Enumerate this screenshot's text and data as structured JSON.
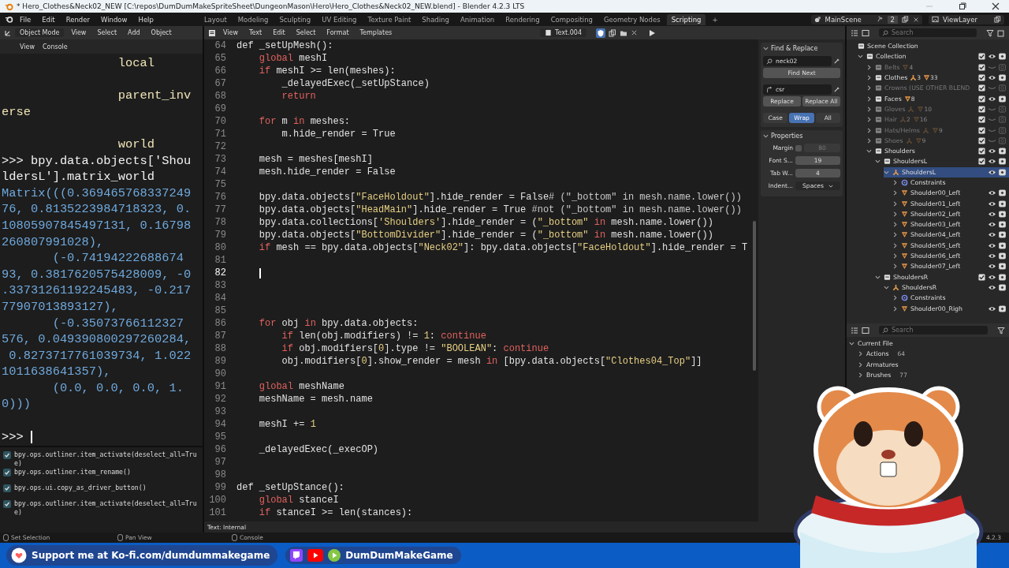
{
  "window": {
    "title": "* Hero_Clothes&Neck02_NEW [C:\\repos\\DumDumMakeSpriteSheet\\DungeonMason\\Hero\\Hero_Clothes&Neck02_NEW.blend] - Blender 4.2.3 LTS"
  },
  "menu": [
    "File",
    "Edit",
    "Render",
    "Window",
    "Help"
  ],
  "workspaces": [
    {
      "label": "Layout",
      "selected": false
    },
    {
      "label": "Modeling",
      "selected": false
    },
    {
      "label": "Sculpting",
      "selected": false
    },
    {
      "label": "UV Editing",
      "selected": false
    },
    {
      "label": "Texture Paint",
      "selected": false
    },
    {
      "label": "Shading",
      "selected": false
    },
    {
      "label": "Animation",
      "selected": false
    },
    {
      "label": "Rendering",
      "selected": false
    },
    {
      "label": "Compositing",
      "selected": false
    },
    {
      "label": "Geometry Nodes",
      "selected": false
    },
    {
      "label": "Scripting",
      "selected": true
    }
  ],
  "add_workspace": "+",
  "scene": {
    "name": "MainScene",
    "users": "2",
    "view_layer": "ViewLayer"
  },
  "viewport_header": {
    "mode": "Object Mode",
    "menus": [
      "View",
      "Select",
      "Add",
      "Object"
    ]
  },
  "console": {
    "menus": [
      "View",
      "Console"
    ],
    "prompt": ">>> ",
    "lines": [
      {
        "kind": "output",
        "text": "                local"
      },
      {
        "kind": "blank"
      },
      {
        "kind": "output",
        "text": "                parent_inv"
      },
      {
        "kind": "output",
        "text": "erse"
      },
      {
        "kind": "blank"
      },
      {
        "kind": "output",
        "text": "                world"
      },
      {
        "kind": "input",
        "text": ">>> bpy.data.objects['Shou"
      },
      {
        "kind": "input",
        "text": "ldersL'].matrix_world"
      },
      {
        "kind": "result",
        "text": "Matrix(((0.369465768337249"
      },
      {
        "kind": "result",
        "text": "76, 0.8135223984718323, 0."
      },
      {
        "kind": "result",
        "text": "10805907845497131, 0.16798"
      },
      {
        "kind": "result",
        "text": "260807991028),"
      },
      {
        "kind": "result",
        "text": "       (-0.74194222688674"
      },
      {
        "kind": "result",
        "text": "93, 0.3817620575428009, -0"
      },
      {
        "kind": "result",
        "text": ".33731261192245483, -0.217"
      },
      {
        "kind": "result",
        "text": "77907013893127),"
      },
      {
        "kind": "result",
        "text": "       (-0.35073766112327"
      },
      {
        "kind": "result",
        "text": "576, 0.049390800297260284,"
      },
      {
        "kind": "result",
        "text": " 0.8273717761039734, 1.022"
      },
      {
        "kind": "result",
        "text": "1011638641357),"
      },
      {
        "kind": "result",
        "text": "       (0.0, 0.0, 0.0, 1."
      },
      {
        "kind": "result",
        "text": "0)))"
      },
      {
        "kind": "blank"
      }
    ]
  },
  "info": {
    "reports": [
      "bpy.ops.outliner.item_activate(deselect_all=True)",
      "bpy.ops.outliner.item_rename()",
      "bpy.ops.ui.copy_as_driver_button()",
      "bpy.ops.outliner.item_activate(deselect_all=True)"
    ]
  },
  "text_editor": {
    "menus": [
      "View",
      "Text",
      "Edit",
      "Select",
      "Format",
      "Templates"
    ],
    "text_name": "Text.004",
    "footer": "Text: Internal",
    "lines": [
      {
        "num": "64",
        "current": false,
        "segments": [
          {
            "kind": "txt",
            "text": "def _setUpMesh():"
          }
        ]
      },
      {
        "num": "65",
        "current": false,
        "segments": [
          {
            "kind": "kw",
            "text": "    global"
          },
          {
            "kind": "txt",
            "text": " meshI"
          }
        ]
      },
      {
        "num": "66",
        "current": false,
        "segments": [
          {
            "kind": "kw",
            "text": "    if"
          },
          {
            "kind": "txt",
            "text": " meshI >= len(meshes):"
          }
        ]
      },
      {
        "num": "67",
        "current": false,
        "segments": [
          {
            "kind": "txt",
            "text": "        _delayedExec(_setUpStance)"
          }
        ]
      },
      {
        "num": "68",
        "current": false,
        "segments": [
          {
            "kind": "kw",
            "text": "        return"
          }
        ]
      },
      {
        "num": "69",
        "current": false
      },
      {
        "num": "70",
        "current": false,
        "segments": [
          {
            "kind": "kw",
            "text": "    for"
          },
          {
            "kind": "txt",
            "text": " m "
          },
          {
            "kind": "kw",
            "text": "in"
          },
          {
            "kind": "txt",
            "text": " meshes:"
          }
        ]
      },
      {
        "num": "71",
        "current": false,
        "segments": [
          {
            "kind": "txt",
            "text": "        m.hide_render = True"
          }
        ]
      },
      {
        "num": "72",
        "current": false
      },
      {
        "num": "73",
        "current": false,
        "segments": [
          {
            "kind": "txt",
            "text": "    mesh = meshes[meshI]"
          }
        ]
      },
      {
        "num": "74",
        "current": false,
        "segments": [
          {
            "kind": "txt",
            "text": "    mesh.hide_render = False"
          }
        ]
      },
      {
        "num": "75",
        "current": false
      },
      {
        "num": "76",
        "current": false,
        "segments": [
          {
            "kind": "txt",
            "text": "    bpy.data.objects["
          },
          {
            "kind": "str",
            "text": "\"FaceHoldout\""
          },
          {
            "kind": "txt",
            "text": "].hide_render = False"
          },
          {
            "kind": "com",
            "text": "# (\"_bottom\" in mesh.name.lower())"
          }
        ]
      },
      {
        "num": "77",
        "current": false,
        "segments": [
          {
            "kind": "txt",
            "text": "    bpy.data.objects["
          },
          {
            "kind": "str",
            "text": "\"HeadMain\""
          },
          {
            "kind": "txt",
            "text": "].hide_render = True "
          },
          {
            "kind": "com",
            "text": "#not (\"_bottom\" in mesh.name.lower())"
          }
        ]
      },
      {
        "num": "78",
        "current": false,
        "segments": [
          {
            "kind": "txt",
            "text": "    bpy.data.collections["
          },
          {
            "kind": "str",
            "text": "'Shoulders'"
          },
          {
            "kind": "txt",
            "text": "].hide_render = ("
          },
          {
            "kind": "str",
            "text": "\"_bottom\""
          },
          {
            "kind": "kw",
            "text": " in"
          },
          {
            "kind": "txt",
            "text": " mesh.name.lower())"
          }
        ]
      },
      {
        "num": "79",
        "current": false,
        "segments": [
          {
            "kind": "txt",
            "text": "    bpy.data.objects["
          },
          {
            "kind": "str",
            "text": "\"BottomDivider\""
          },
          {
            "kind": "txt",
            "text": "].hide_render = ("
          },
          {
            "kind": "str",
            "text": "\"_bottom\""
          },
          {
            "kind": "kw",
            "text": " in"
          },
          {
            "kind": "txt",
            "text": " mesh.name.lower())"
          }
        ]
      },
      {
        "num": "80",
        "current": false,
        "segments": [
          {
            "kind": "kw",
            "text": "    if"
          },
          {
            "kind": "txt",
            "text": " mesh == bpy.data.objects["
          },
          {
            "kind": "str",
            "text": "\"Neck02\""
          },
          {
            "kind": "txt",
            "text": "]: bpy.data.objects["
          },
          {
            "kind": "str",
            "text": "\"FaceHoldout\""
          },
          {
            "kind": "txt",
            "text": "].hide_render = T"
          }
        ]
      },
      {
        "num": "81",
        "current": false
      },
      {
        "num": "82",
        "current": true
      },
      {
        "num": "83",
        "current": false
      },
      {
        "num": "84",
        "current": false
      },
      {
        "num": "85",
        "current": false
      },
      {
        "num": "86",
        "current": false,
        "segments": [
          {
            "kind": "kw",
            "text": "    for"
          },
          {
            "kind": "txt",
            "text": " obj "
          },
          {
            "kind": "kw",
            "text": "in"
          },
          {
            "kind": "txt",
            "text": " bpy.data.objects:"
          }
        ]
      },
      {
        "num": "87",
        "current": false,
        "segments": [
          {
            "kind": "kw",
            "text": "        if"
          },
          {
            "kind": "txt",
            "text": " len(obj.modifiers) != "
          },
          {
            "kind": "num",
            "text": "1"
          },
          {
            "kind": "txt",
            "text": ": "
          },
          {
            "kind": "kw",
            "text": "continue"
          }
        ]
      },
      {
        "num": "88",
        "current": false,
        "segments": [
          {
            "kind": "kw",
            "text": "        if"
          },
          {
            "kind": "txt",
            "text": " obj.modifiers["
          },
          {
            "kind": "num",
            "text": "0"
          },
          {
            "kind": "txt",
            "text": "].type != "
          },
          {
            "kind": "str",
            "text": "\"BOOLEAN\""
          },
          {
            "kind": "txt",
            "text": ": "
          },
          {
            "kind": "kw",
            "text": "continue"
          }
        ]
      },
      {
        "num": "89",
        "current": false,
        "segments": [
          {
            "kind": "txt",
            "text": "        obj.modifiers["
          },
          {
            "kind": "num",
            "text": "0"
          },
          {
            "kind": "txt",
            "text": "].show_render = mesh "
          },
          {
            "kind": "kw",
            "text": "in"
          },
          {
            "kind": "txt",
            "text": " [bpy.data.objects["
          },
          {
            "kind": "str",
            "text": "\"Clothes04_Top\""
          },
          {
            "kind": "txt",
            "text": "]]"
          }
        ]
      },
      {
        "num": "90",
        "current": false
      },
      {
        "num": "91",
        "current": false,
        "segments": [
          {
            "kind": "kw",
            "text": "    global"
          },
          {
            "kind": "txt",
            "text": " meshName"
          }
        ]
      },
      {
        "num": "92",
        "current": false,
        "segments": [
          {
            "kind": "txt",
            "text": "    meshName = mesh.name"
          }
        ]
      },
      {
        "num": "93",
        "current": false
      },
      {
        "num": "94",
        "current": false,
        "segments": [
          {
            "kind": "txt",
            "text": "    meshI += "
          },
          {
            "kind": "num",
            "text": "1"
          }
        ]
      },
      {
        "num": "95",
        "current": false
      },
      {
        "num": "96",
        "current": false,
        "segments": [
          {
            "kind": "txt",
            "text": "    _delayedExec(_execOP)"
          }
        ]
      },
      {
        "num": "97",
        "current": false
      },
      {
        "num": "98",
        "current": false
      },
      {
        "num": "99",
        "current": false,
        "segments": [
          {
            "kind": "txt",
            "text": "def _setUpStance():"
          }
        ]
      },
      {
        "num": "100",
        "current": false,
        "segments": [
          {
            "kind": "kw",
            "text": "    global"
          },
          {
            "kind": "txt",
            "text": " stanceI"
          }
        ]
      },
      {
        "num": "101",
        "current": false,
        "segments": [
          {
            "kind": "kw",
            "text": "    if"
          },
          {
            "kind": "txt",
            "text": " stanceI >= len(stances):"
          }
        ]
      }
    ]
  },
  "find_replace": {
    "title": "Find & Replace",
    "find": "neck02",
    "find_button": "Find Next",
    "replace": "csr",
    "replace_buttons": [
      "Replace",
      "Replace All"
    ],
    "toggles": [
      {
        "label": "Case",
        "on": false
      },
      {
        "label": "Wrap",
        "on": true
      },
      {
        "label": "All",
        "on": false
      }
    ]
  },
  "properties": {
    "title": "Properties",
    "fields": [
      {
        "kind": "checkbox-number",
        "label": "Margin",
        "value": "80",
        "checked": false
      },
      {
        "kind": "number",
        "label": "Font S...",
        "value": "19"
      },
      {
        "kind": "number",
        "label": "Tab W...",
        "value": "4"
      },
      {
        "kind": "dropdown",
        "label": "Indent...",
        "value": "Spaces"
      }
    ]
  },
  "outliner": {
    "search_placeholder": "Search",
    "tree": [
      {
        "kind": "scene",
        "name": "Scene Collection",
        "selected": false,
        "children": [
          {
            "kind": "collection",
            "name": "Collection",
            "expanded": true,
            "checked": true,
            "visible": true,
            "selected": false,
            "children": [
              {
                "kind": "collection",
                "name": "Belts",
                "expanded": false,
                "checked": true,
                "visible": false,
                "selected": false,
                "badges": [
                  {
                    "kind": "mesh",
                    "count": "4"
                  }
                ]
              },
              {
                "kind": "collection",
                "name": "Clothes",
                "expanded": false,
                "checked": true,
                "visible": true,
                "selected": false,
                "badges": [
                  {
                    "kind": "armature",
                    "count": "3"
                  },
                  {
                    "kind": "mesh",
                    "count": "33"
                  }
                ]
              },
              {
                "kind": "collection",
                "name": "Crowns (USE OTHER BLEND",
                "expanded": false,
                "checked": true,
                "visible": false,
                "selected": false
              },
              {
                "kind": "collection",
                "name": "Faces",
                "expanded": false,
                "checked": true,
                "visible": true,
                "selected": false,
                "badges": [
                  {
                    "kind": "mesh",
                    "count": "8"
                  }
                ]
              },
              {
                "kind": "collection",
                "name": "Gloves",
                "expanded": false,
                "checked": true,
                "visible": false,
                "selected": false,
                "badges": [
                  {
                    "kind": "armature"
                  },
                  {
                    "kind": "mesh",
                    "count": "10"
                  }
                ]
              },
              {
                "kind": "collection",
                "name": "Hair",
                "expanded": false,
                "checked": true,
                "visible": false,
                "selected": false,
                "badges": [
                  {
                    "kind": "armature",
                    "count": "2"
                  },
                  {
                    "kind": "mesh",
                    "count": "16"
                  }
                ]
              },
              {
                "kind": "collection",
                "name": "Hats/Helms",
                "expanded": false,
                "checked": true,
                "visible": false,
                "selected": false,
                "badges": [
                  {
                    "kind": "armature"
                  },
                  {
                    "kind": "mesh",
                    "count": "9"
                  }
                ]
              },
              {
                "kind": "collection",
                "name": "Shoes",
                "expanded": false,
                "checked": true,
                "visible": false,
                "selected": false,
                "badges": [
                  {
                    "kind": "armature"
                  },
                  {
                    "kind": "mesh",
                    "count": "9"
                  }
                ]
              },
              {
                "kind": "collection",
                "name": "Shoulders",
                "expanded": true,
                "checked": true,
                "visible": true,
                "selected": false,
                "children": [
                  {
                    "kind": "collection",
                    "name": "ShouldersL",
                    "expanded": true,
                    "checked": true,
                    "visible": true,
                    "selected": false,
                    "children": [
                      {
                        "kind": "armature",
                        "name": "ShouldersL",
                        "expanded": true,
                        "visible": true,
                        "selected": true,
                        "children": [
                          {
                            "kind": "constraints",
                            "name": "Constraints",
                            "expanded": false,
                            "selected": false
                          },
                          {
                            "kind": "mesh",
                            "name": "Shoulder00_Left",
                            "expanded": false,
                            "visible": true,
                            "selected": false
                          },
                          {
                            "kind": "mesh",
                            "name": "Shoulder01_Left",
                            "expanded": false,
                            "visible": true,
                            "selected": false
                          },
                          {
                            "kind": "mesh",
                            "name": "Shoulder02_Left",
                            "expanded": false,
                            "visible": true,
                            "selected": false
                          },
                          {
                            "kind": "mesh",
                            "name": "Shoulder03_Left",
                            "expanded": false,
                            "visible": true,
                            "selected": false
                          },
                          {
                            "kind": "mesh",
                            "name": "Shoulder04_Left",
                            "expanded": false,
                            "visible": true,
                            "selected": false
                          },
                          {
                            "kind": "mesh",
                            "name": "Shoulder05_Left",
                            "expanded": false,
                            "visible": true,
                            "selected": false
                          },
                          {
                            "kind": "mesh",
                            "name": "Shoulder06_Left",
                            "expanded": false,
                            "visible": true,
                            "selected": false
                          },
                          {
                            "kind": "mesh",
                            "name": "Shoulder07_Left",
                            "expanded": false,
                            "visible": true,
                            "selected": false
                          }
                        ]
                      }
                    ]
                  },
                  {
                    "kind": "collection",
                    "name": "ShouldersR",
                    "expanded": true,
                    "checked": true,
                    "visible": true,
                    "selected": false,
                    "children": [
                      {
                        "kind": "armature",
                        "name": "ShouldersR",
                        "expanded": true,
                        "visible": true,
                        "selected": false,
                        "children": [
                          {
                            "kind": "constraints",
                            "name": "Constraints",
                            "expanded": false,
                            "selected": false
                          },
                          {
                            "kind": "mesh",
                            "name": "Shoulder00_Righ",
                            "expanded": false,
                            "visible": true,
                            "selected": false
                          }
                        ]
                      }
                    ]
                  }
                ]
              }
            ]
          }
        ]
      }
    ]
  },
  "file_outliner": {
    "search_placeholder": "Search",
    "root": "Current File",
    "expanded": true,
    "items": [
      {
        "name": "Actions",
        "badge": "64",
        "expanded": false
      },
      {
        "name": "Armatures",
        "expanded": false
      },
      {
        "name": "Brushes",
        "badge": "77",
        "expanded": false
      }
    ]
  },
  "status_bar": {
    "hints": [
      "Set Selection",
      "Pan View",
      "Console"
    ],
    "version": "4.2.3"
  },
  "banner": {
    "kofi": "Support me at Ko-fi.com/dumdummakegame",
    "channel": "DumDumMakeGame"
  }
}
